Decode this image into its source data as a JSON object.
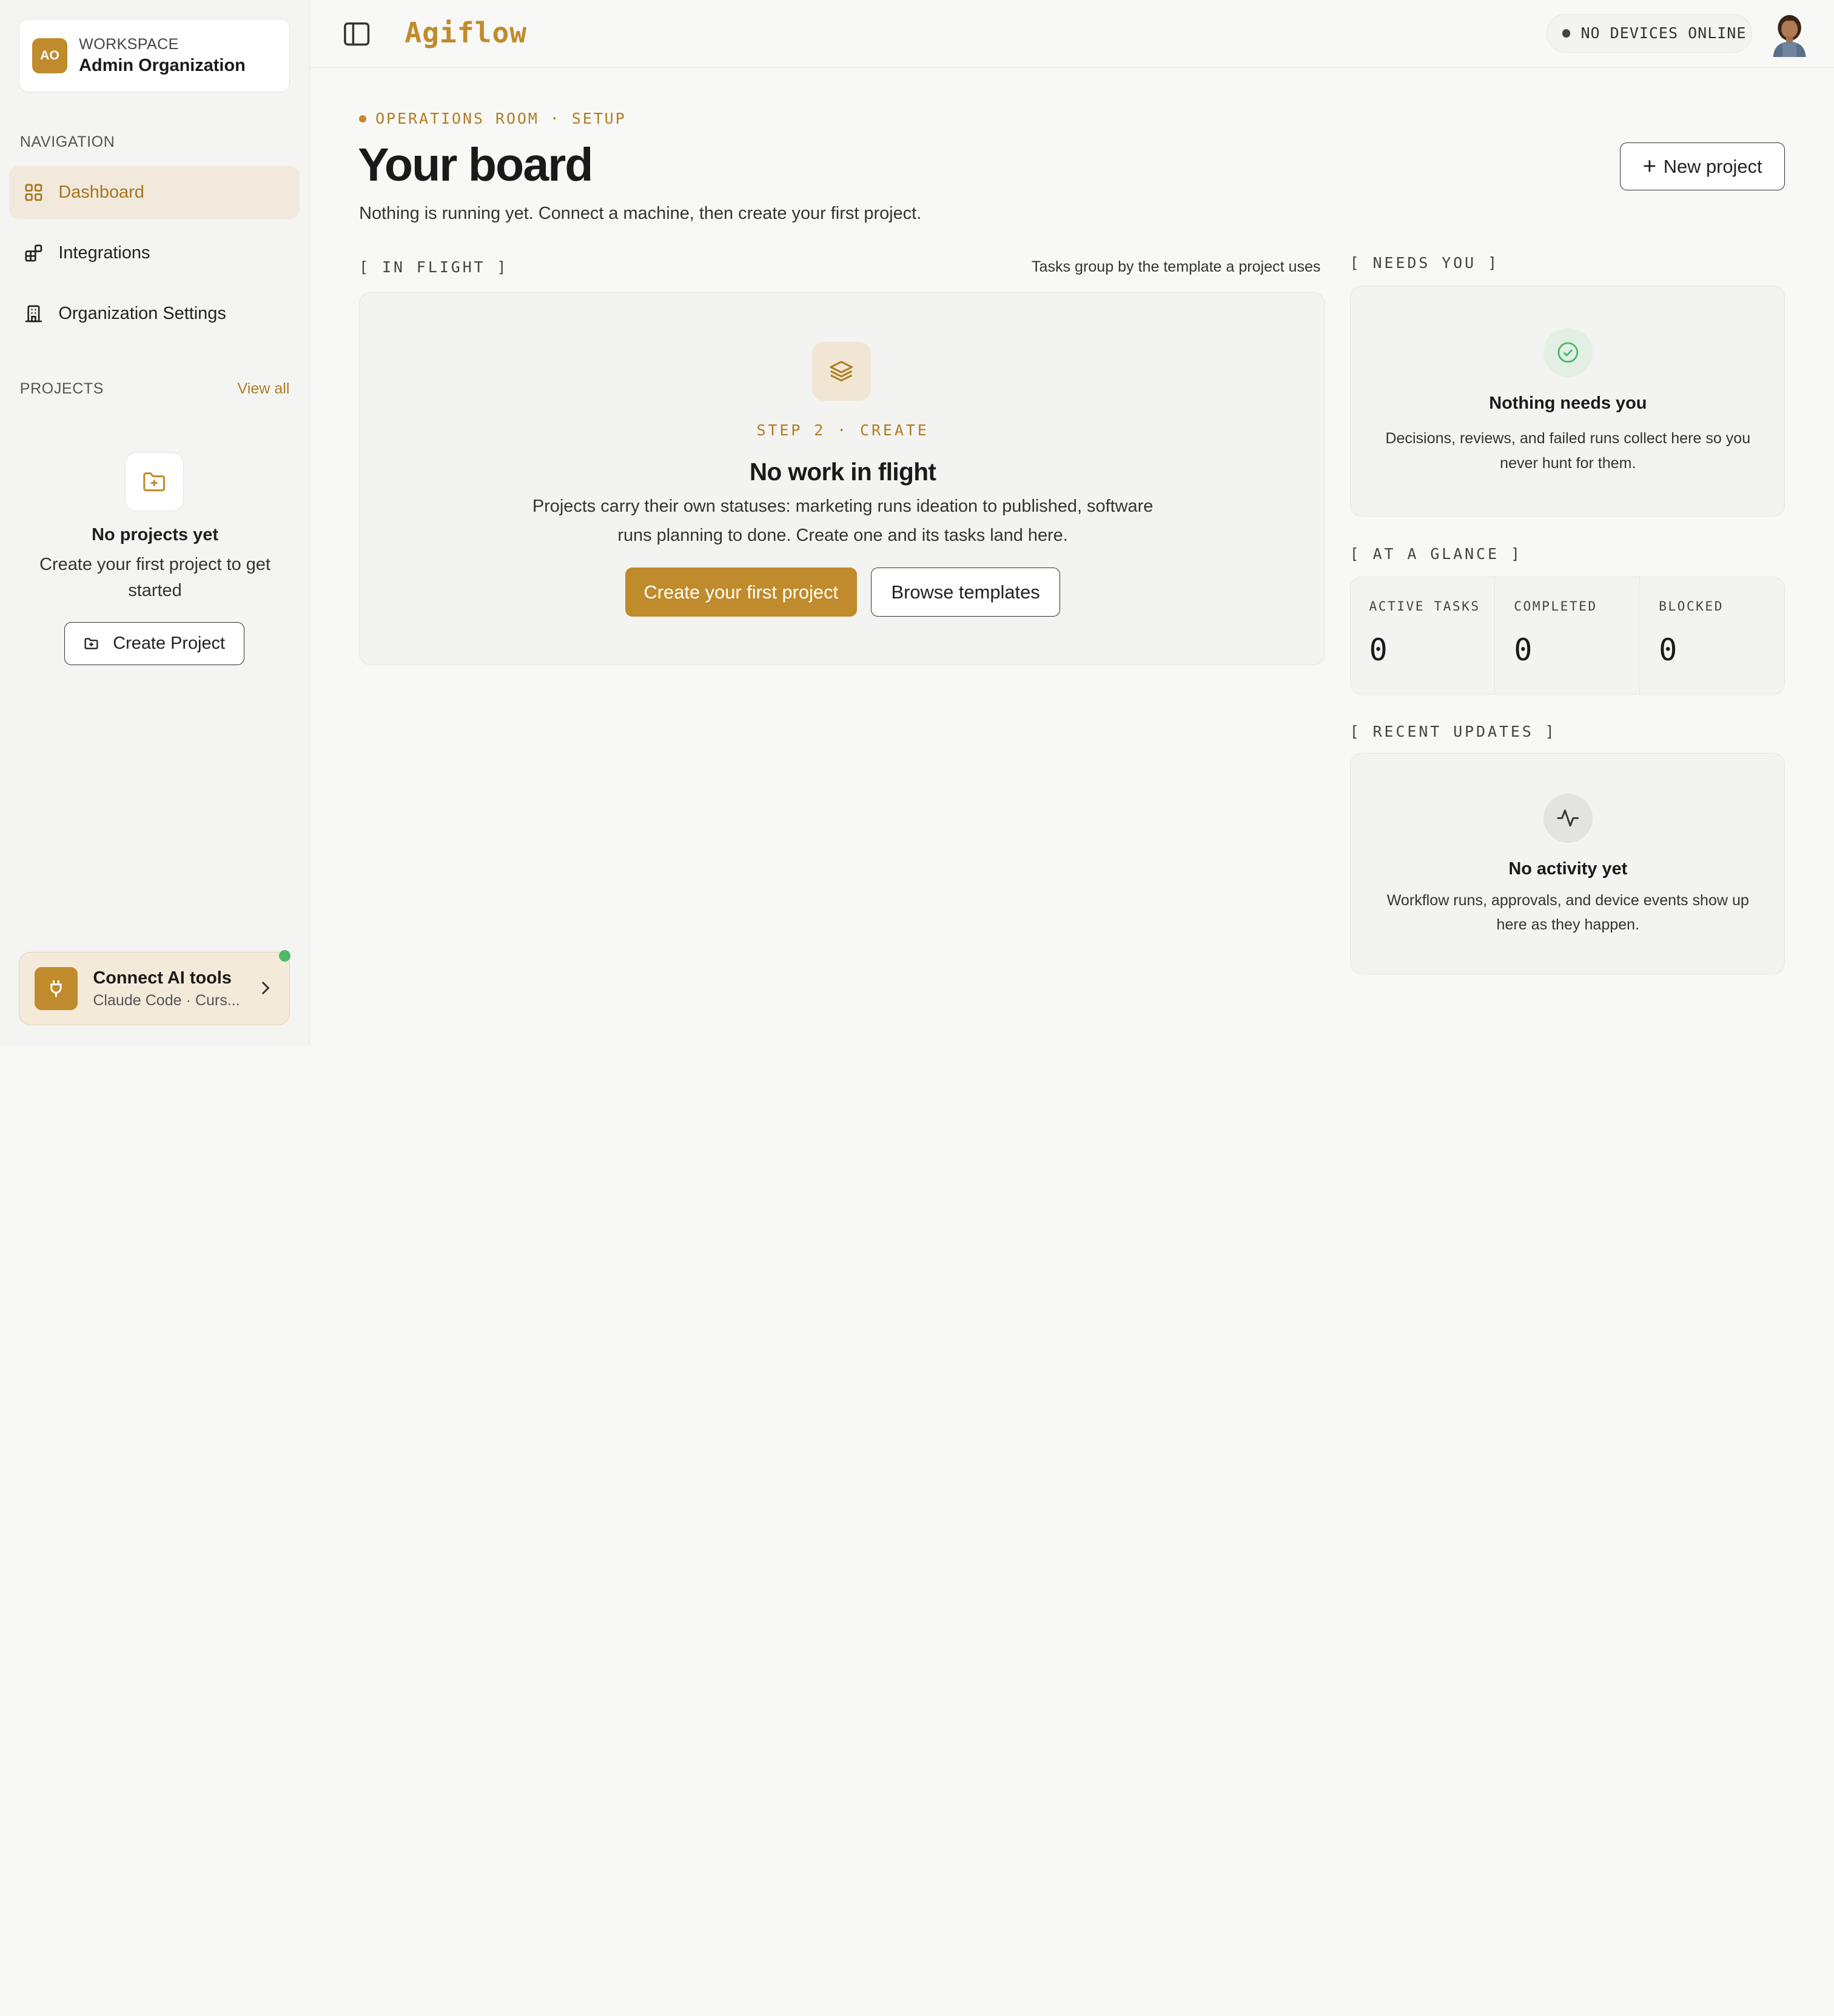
{
  "workspace": {
    "initials": "AO",
    "label": "WORKSPACE",
    "name": "Admin Organization"
  },
  "sidebar": {
    "nav_label": "NAVIGATION",
    "items": [
      {
        "label": "Dashboard",
        "icon": "grid-icon",
        "active": true
      },
      {
        "label": "Integrations",
        "icon": "blocks-icon",
        "active": false
      },
      {
        "label": "Organization Settings",
        "icon": "building-icon",
        "active": false
      }
    ],
    "projects_label": "PROJECTS",
    "view_all": "View all",
    "empty_title": "No projects yet",
    "empty_sub": "Create your first project to get started",
    "create_button": "Create Project",
    "connect": {
      "title": "Connect AI tools",
      "subtitle": "Claude Code · Curs..."
    }
  },
  "topbar": {
    "brand": "Agiflow",
    "devices": "NO DEVICES ONLINE"
  },
  "main": {
    "breadcrumb": "OPERATIONS ROOM · SETUP",
    "title": "Your board",
    "subtitle": "Nothing is running yet. Connect a machine, then create your first project.",
    "new_project": "New project",
    "in_flight": {
      "label": "[ IN FLIGHT ]",
      "note": "Tasks group by the template a project uses",
      "step": "STEP 2 · CREATE",
      "title": "No work in flight",
      "description": "Projects carry their own statuses: marketing runs ideation to published, software runs planning to done. Create one and its tasks land here.",
      "primary_button": "Create your first project",
      "secondary_button": "Browse templates"
    },
    "needs_you": {
      "label": "[ NEEDS YOU ]",
      "title": "Nothing needs you",
      "description": "Decisions, reviews, and failed runs collect here so you never hunt for them."
    },
    "at_a_glance": {
      "label": "[ AT A GLANCE ]",
      "stats": [
        {
          "label": "ACTIVE TASKS",
          "value": "0"
        },
        {
          "label": "COMPLETED",
          "value": "0"
        },
        {
          "label": "BLOCKED",
          "value": "0"
        }
      ]
    },
    "recent_updates": {
      "label": "[ RECENT UPDATES ]",
      "title": "No activity yet",
      "description": "Workflow runs, approvals, and device events show up here as they happen."
    }
  },
  "colors": {
    "accent": "#c08b2c",
    "active_bg": "#f1e9dc",
    "success": "#4cb96a"
  }
}
